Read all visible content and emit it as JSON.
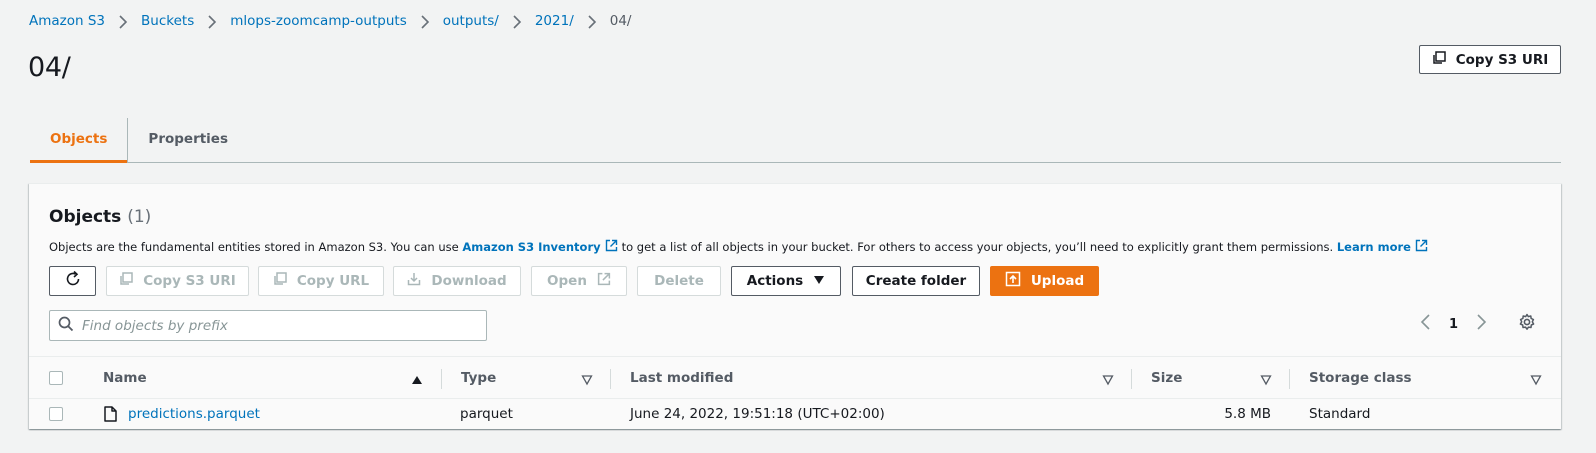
{
  "breadcrumb": [
    "Amazon S3",
    "Buckets",
    "mlops-zoomcamp-outputs",
    "outputs/",
    "2021/",
    "04/"
  ],
  "page_title": "04/",
  "copy_s3_uri_label": "Copy S3 URI",
  "tabs": [
    {
      "label": "Objects",
      "active": true
    },
    {
      "label": "Properties",
      "active": false
    }
  ],
  "objects": {
    "title": "Objects",
    "count": "(1)",
    "desc_before": "Objects are the fundamental entities stored in Amazon S3. You can use",
    "inventory_link": "Amazon S3 Inventory",
    "desc_middle": "to get a list of all objects in your bucket. For others to access your objects, you’ll need to explicitly grant them permissions.",
    "learn_more": "Learn more"
  },
  "toolbar": {
    "copy_s3_uri": "Copy S3 URI",
    "copy_url": "Copy URL",
    "download": "Download",
    "open": "Open",
    "delete": "Delete",
    "actions": "Actions",
    "create_folder": "Create folder",
    "upload": "Upload"
  },
  "search": {
    "placeholder": "Find objects by prefix",
    "value": ""
  },
  "pagination": {
    "page": "1"
  },
  "table": {
    "columns": [
      "Name",
      "Type",
      "Last modified",
      "Size",
      "Storage class"
    ],
    "rows": [
      {
        "name": "predictions.parquet",
        "type": "parquet",
        "last_modified": "June 24, 2022, 19:51:18 (UTC+02:00)",
        "size": "5.8 MB",
        "storage_class": "Standard"
      }
    ]
  },
  "colors": {
    "accent": "#ec7211",
    "link": "#0073bb",
    "text": "#16191f",
    "muted": "#545b64"
  },
  "icons": [
    "chevron-right-icon",
    "copy-icon",
    "refresh-icon",
    "download-icon",
    "external-link-icon",
    "caret-down-icon",
    "upload-icon",
    "search-icon",
    "chevron-left-icon",
    "gear-icon",
    "sort-asc-icon",
    "sort-icon",
    "file-icon"
  ]
}
